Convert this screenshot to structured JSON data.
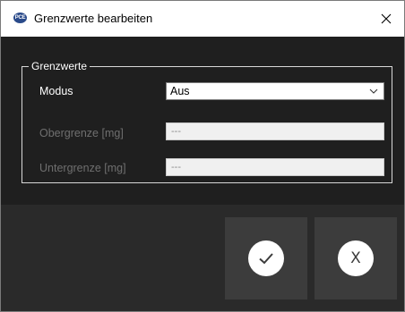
{
  "window": {
    "title": "Grenzwerte bearbeiten",
    "app_icon_text": "PCE"
  },
  "group": {
    "legend": "Grenzwerte"
  },
  "fields": {
    "modus": {
      "label": "Modus",
      "value": "Aus"
    },
    "obergrenze": {
      "label": "Obergrenze [mg]",
      "value": "---"
    },
    "untergrenze": {
      "label": "Untergrenze [mg]",
      "value": "---"
    }
  },
  "icons": {
    "ok": "check-icon",
    "cancel": "x-icon",
    "close": "close-icon",
    "dropdown": "chevron-down-icon"
  },
  "buttons": {
    "cancel_glyph": "X"
  },
  "colors": {
    "background": "#1f1f1f",
    "button": "#3c3c3c",
    "disabled_text": "#6f6f6f"
  }
}
